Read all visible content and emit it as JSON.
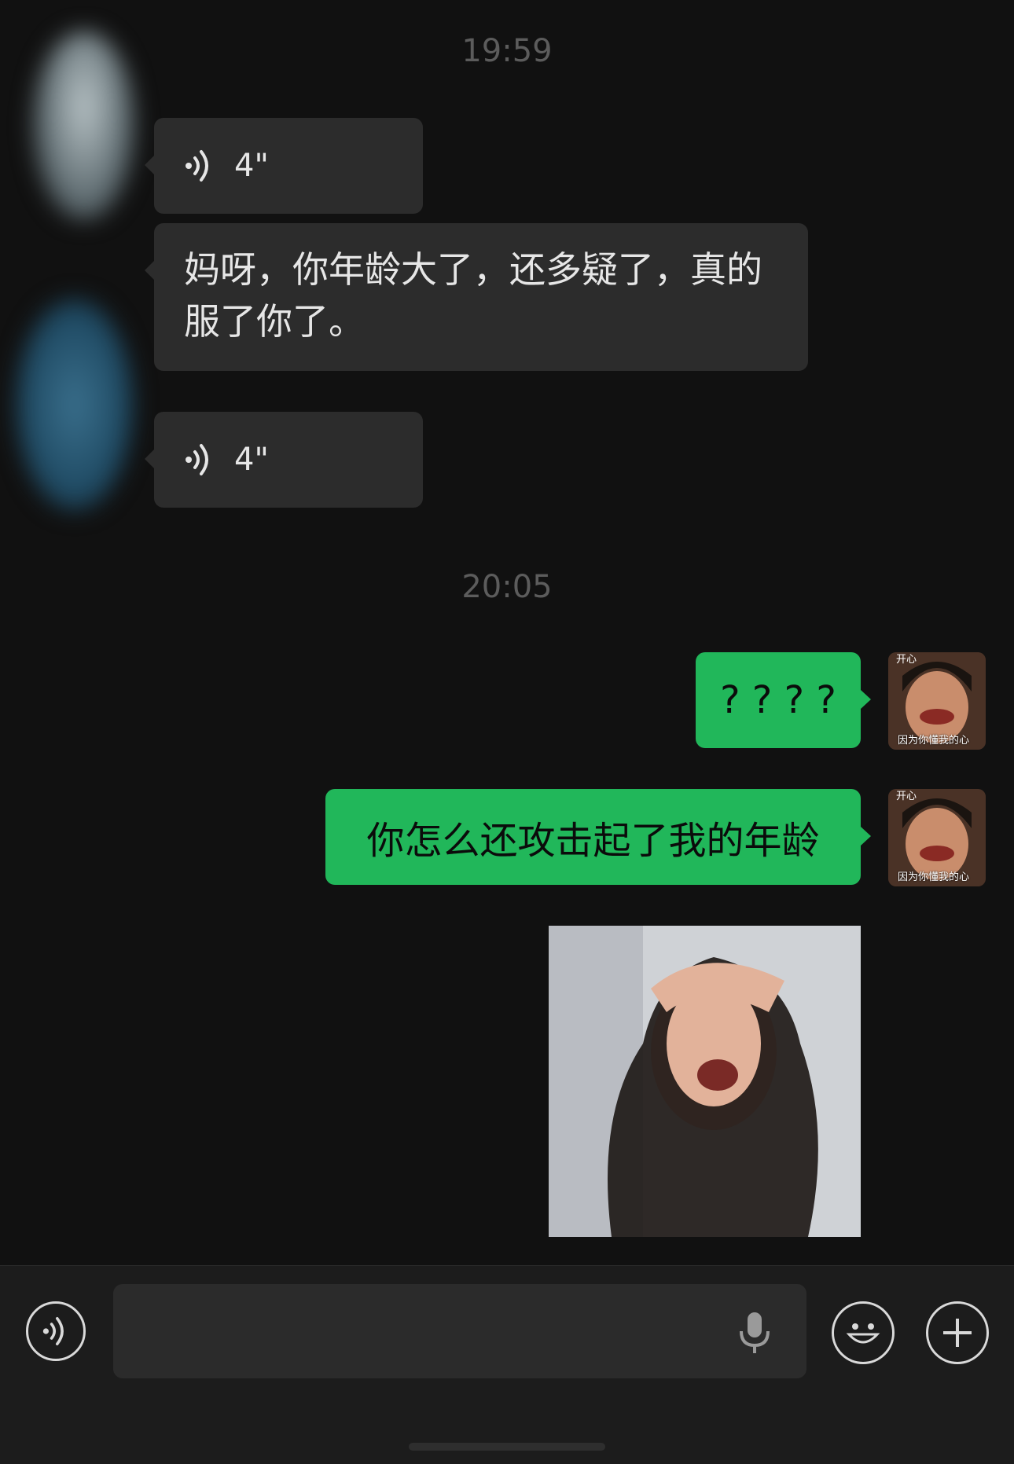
{
  "timestamps": [
    "19:59",
    "20:05"
  ],
  "messages_in": {
    "voice_1": "4\"",
    "text_1": "妈呀，你年龄大了，还多疑了，真的服了你了。",
    "voice_2": "4\""
  },
  "messages_out": {
    "text_1": "? ? ? ?",
    "text_2": "你怎么还攻击起了我的年龄"
  },
  "avatar_caption_top": "开心",
  "avatar_caption_bottom": "因为你懂我的心",
  "input": {
    "placeholder": ""
  },
  "colors": {
    "background": "#111111",
    "bubble_in": "#2c2c2c",
    "bubble_out": "#21b75a"
  },
  "icons": [
    "voice-wave-icon",
    "microphone-icon",
    "emoji-icon",
    "plus-icon"
  ]
}
